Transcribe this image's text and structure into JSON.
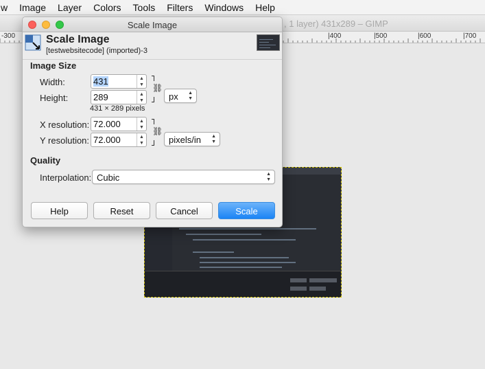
{
  "menubar": {
    "items": [
      "w",
      "Image",
      "Layer",
      "Colors",
      "Tools",
      "Filters",
      "Windows",
      "Help"
    ]
  },
  "gimp_window": {
    "title": ", 1 layer) 431x289 – GIMP",
    "ruler_labels": [
      "-300",
      "|400",
      "|500",
      "|600",
      "|700"
    ]
  },
  "dialog": {
    "title": "Scale Image",
    "header_title": "Scale Image",
    "header_subtitle": "[testwebsitecode] (imported)-3",
    "image_size": {
      "section_label": "Image Size",
      "width_label": "Width:",
      "width_value": "431",
      "height_label": "Height:",
      "height_value": "289",
      "unit": "px",
      "size_summary": "431 × 289 pixels",
      "xres_label": "X resolution:",
      "xres_value": "72.000",
      "yres_label": "Y resolution:",
      "yres_value": "72.000",
      "res_unit": "pixels/in"
    },
    "quality": {
      "section_label": "Quality",
      "interpolation_label": "Interpolation:",
      "interpolation_value": "Cubic"
    },
    "buttons": {
      "help": "Help",
      "reset": "Reset",
      "cancel": "Cancel",
      "scale": "Scale"
    }
  },
  "colors": {
    "accent": "#1b84f5",
    "selection": "#b3d4fc",
    "canvas_bg": "#e8e8e8"
  },
  "icons": [
    "scale-image-icon",
    "chain-link-icon",
    "spin-arrows-icon",
    "dropdown-arrows-icon"
  ]
}
